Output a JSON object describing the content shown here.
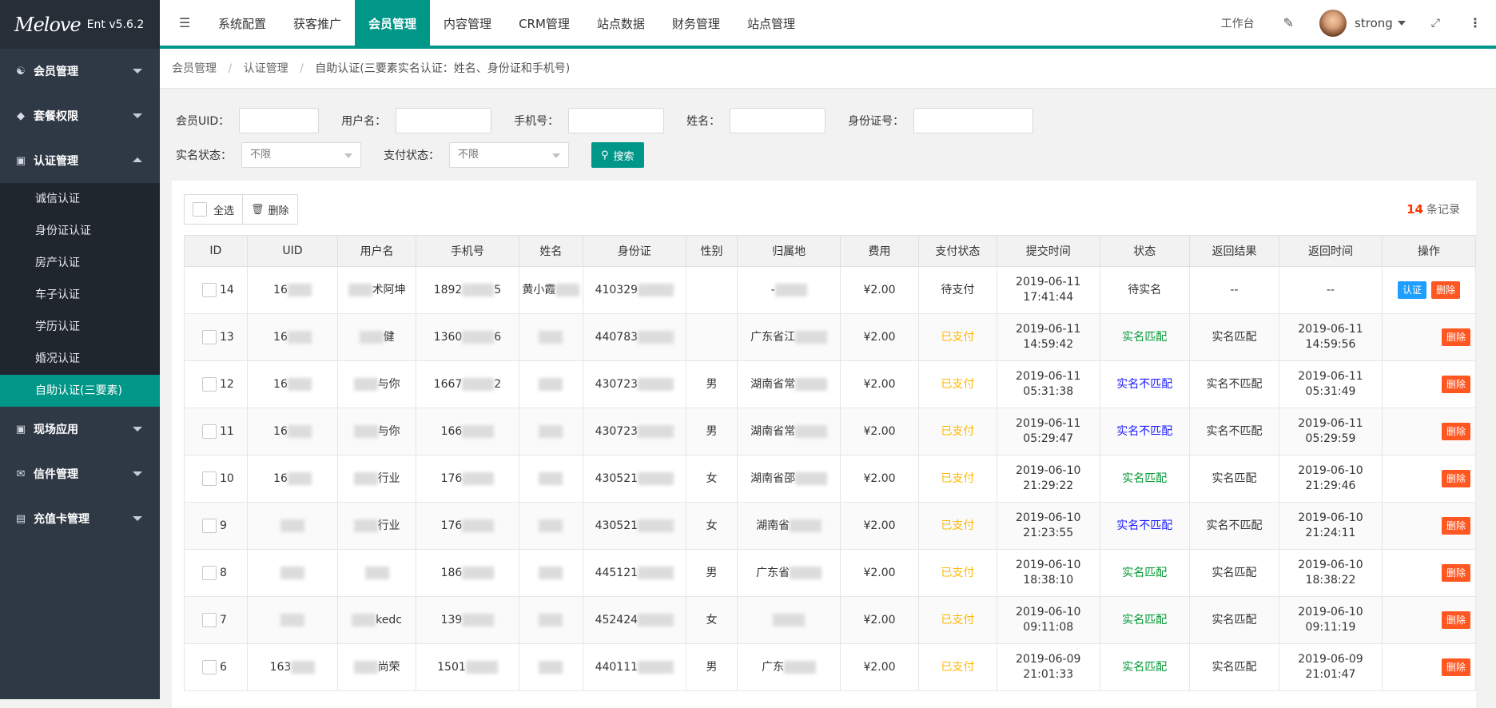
{
  "app": {
    "logo_text": "Melove",
    "version": "Ent v5.6.2"
  },
  "sidebar": {
    "groups": [
      {
        "label": "会员管理",
        "icon": "users-icon"
      },
      {
        "label": "套餐权限",
        "icon": "shield-icon"
      },
      {
        "label": "认证管理",
        "icon": "image-icon"
      },
      {
        "label": "现场应用",
        "icon": "image-icon"
      },
      {
        "label": "信件管理",
        "icon": "mail-icon"
      },
      {
        "label": "充值卡管理",
        "icon": "card-icon"
      }
    ],
    "sub": [
      "诚信认证",
      "身份证认证",
      "房产认证",
      "车子认证",
      "学历认证",
      "婚况认证",
      "自助认证(三要素)"
    ]
  },
  "topnav": {
    "items": [
      "系统配置",
      "获客推广",
      "会员管理",
      "内容管理",
      "CRM管理",
      "站点数据",
      "财务管理",
      "站点管理"
    ],
    "active": "会员管理",
    "workbench": "工作台",
    "username": "strong"
  },
  "breadcrumb": {
    "items": [
      "会员管理",
      "认证管理"
    ],
    "current": "自助认证(三要素实名认证：姓名、身份证和手机号)",
    "sep": "/"
  },
  "search": {
    "labels": {
      "uid": "会员UID：",
      "username": "用户名：",
      "phone": "手机号：",
      "name": "姓名：",
      "idcard": "身份证号：",
      "realname_status": "实名状态：",
      "pay_status": "支付状态："
    },
    "realname_value": "不限",
    "pay_value": "不限",
    "button": "搜索"
  },
  "toolbar": {
    "select_all": "全选",
    "delete": "删除",
    "count": "14",
    "count_suffix": "条记录"
  },
  "table": {
    "headers": [
      "ID",
      "UID",
      "用户名",
      "手机号",
      "姓名",
      "身份证",
      "性别",
      "归属地",
      "费用",
      "支付状态",
      "提交时间",
      "状态",
      "返回结果",
      "返回时间",
      "操作"
    ],
    "verify_label": "认证",
    "delete_label": "删除",
    "rows": [
      {
        "id": "14",
        "uid": "16",
        "username": "术阿坤",
        "phone_a": "1892",
        "phone_b": "5",
        "name": "黄小霞",
        "idcard": "410329",
        "gender": "",
        "region": "-",
        "fee": "¥2.00",
        "pay": "待支付",
        "submit_date": "2019-06-11",
        "submit_time": "17:41:44",
        "status": "待实名",
        "result": "--",
        "ret_date": "--",
        "ret_time": "",
        "verify": true
      },
      {
        "id": "13",
        "uid": "16",
        "username": "健",
        "phone_a": "1360",
        "phone_b": "6",
        "name": "",
        "idcard": "440783",
        "gender": "",
        "region": "广东省江",
        "fee": "¥2.00",
        "pay": "已支付",
        "submit_date": "2019-06-11",
        "submit_time": "14:59:42",
        "status": "实名匹配",
        "result": "实名匹配",
        "ret_date": "2019-06-11",
        "ret_time": "14:59:56",
        "verify": false
      },
      {
        "id": "12",
        "uid": "16",
        "username": "与你",
        "phone_a": "1667",
        "phone_b": "2",
        "name": "",
        "idcard": "430723",
        "gender": "男",
        "region": "湖南省常",
        "fee": "¥2.00",
        "pay": "已支付",
        "submit_date": "2019-06-11",
        "submit_time": "05:31:38",
        "status": "实名不匹配",
        "result": "实名不匹配",
        "ret_date": "2019-06-11",
        "ret_time": "05:31:49",
        "verify": false
      },
      {
        "id": "11",
        "uid": "16",
        "username": "与你",
        "phone_a": "166",
        "phone_b": "",
        "name": "",
        "idcard": "430723",
        "gender": "男",
        "region": "湖南省常",
        "fee": "¥2.00",
        "pay": "已支付",
        "submit_date": "2019-06-11",
        "submit_time": "05:29:47",
        "status": "实名不匹配",
        "result": "实名不匹配",
        "ret_date": "2019-06-11",
        "ret_time": "05:29:59",
        "verify": false
      },
      {
        "id": "10",
        "uid": "16",
        "username": "行业",
        "phone_a": "176",
        "phone_b": "",
        "name": "",
        "idcard": "430521",
        "gender": "女",
        "region": "湖南省邵",
        "fee": "¥2.00",
        "pay": "已支付",
        "submit_date": "2019-06-10",
        "submit_time": "21:29:22",
        "status": "实名匹配",
        "result": "实名匹配",
        "ret_date": "2019-06-10",
        "ret_time": "21:29:46",
        "verify": false
      },
      {
        "id": "9",
        "uid": "",
        "username": "行业",
        "phone_a": "176",
        "phone_b": "",
        "name": "",
        "idcard": "430521",
        "gender": "女",
        "region": "湖南省",
        "fee": "¥2.00",
        "pay": "已支付",
        "submit_date": "2019-06-10",
        "submit_time": "21:23:55",
        "status": "实名不匹配",
        "result": "实名不匹配",
        "ret_date": "2019-06-10",
        "ret_time": "21:24:11",
        "verify": false
      },
      {
        "id": "8",
        "uid": "",
        "username": "",
        "phone_a": "186",
        "phone_b": "",
        "name": "",
        "idcard": "445121",
        "gender": "男",
        "region": "广东省",
        "fee": "¥2.00",
        "pay": "已支付",
        "submit_date": "2019-06-10",
        "submit_time": "18:38:10",
        "status": "实名匹配",
        "result": "实名匹配",
        "ret_date": "2019-06-10",
        "ret_time": "18:38:22",
        "verify": false
      },
      {
        "id": "7",
        "uid": "",
        "username": "kedc",
        "phone_a": "139",
        "phone_b": "",
        "name": "",
        "idcard": "452424",
        "gender": "女",
        "region": "",
        "fee": "¥2.00",
        "pay": "已支付",
        "submit_date": "2019-06-10",
        "submit_time": "09:11:08",
        "status": "实名匹配",
        "result": "实名匹配",
        "ret_date": "2019-06-10",
        "ret_time": "09:11:19",
        "verify": false
      },
      {
        "id": "6",
        "uid": "163",
        "username": "尚荣",
        "phone_a": "1501",
        "phone_b": "",
        "name": "",
        "idcard": "440111",
        "gender": "男",
        "region": "广东",
        "fee": "¥2.00",
        "pay": "已支付",
        "submit_date": "2019-06-09",
        "submit_time": "21:01:33",
        "status": "实名匹配",
        "result": "实名匹配",
        "ret_date": "2019-06-09",
        "ret_time": "21:01:47",
        "verify": false
      }
    ]
  }
}
